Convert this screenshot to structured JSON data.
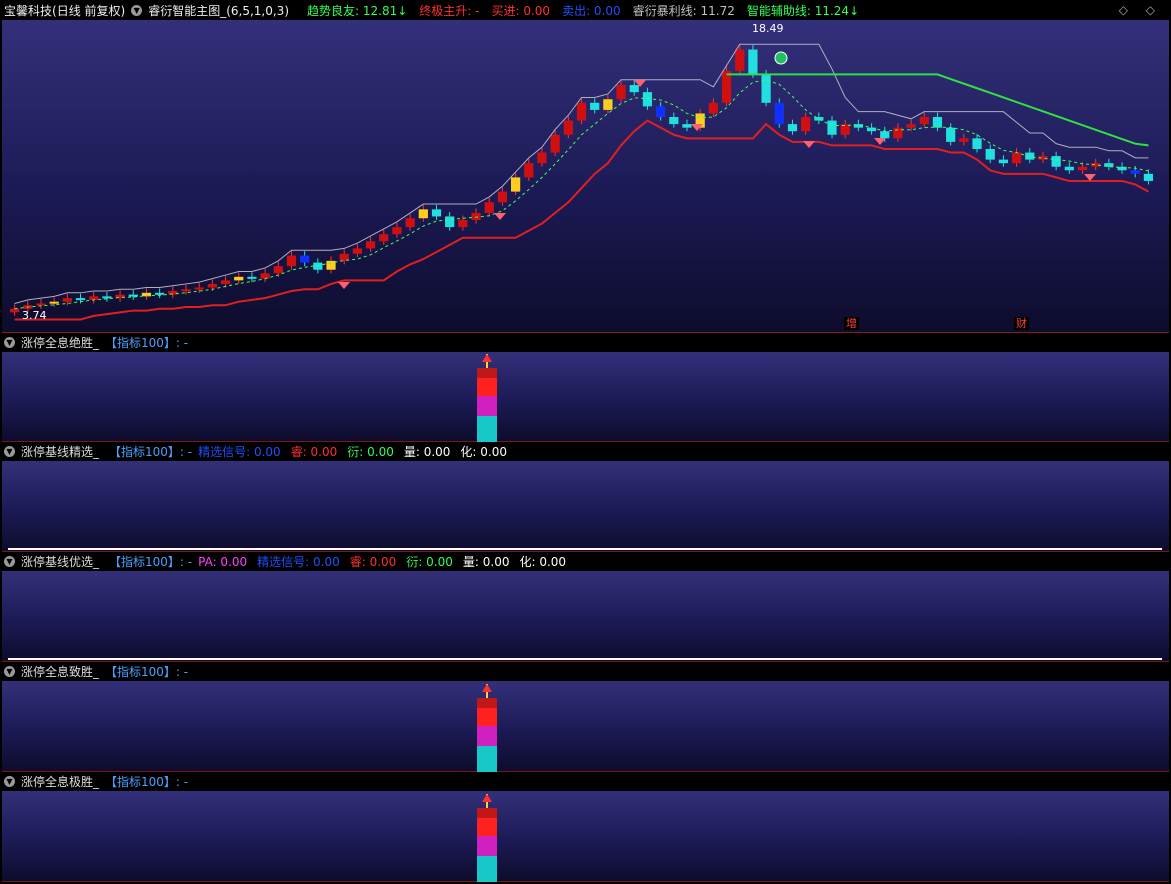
{
  "header": {
    "stock": "宝馨科技",
    "period": "(日线 前复权)",
    "indicator": "睿衍智能主图_(6,5,1,0,3)",
    "legend": [
      {
        "label": "趋势良友:",
        "value": "12.81",
        "arrow": "↓",
        "color": "#33ff55"
      },
      {
        "label": "终极主升:",
        "value": "-",
        "arrow": "",
        "color": "#ff3030"
      },
      {
        "label": "买进:",
        "value": "0.00",
        "arrow": "",
        "color": "#ff3030"
      },
      {
        "label": "卖出:",
        "value": "0.00",
        "arrow": "",
        "color": "#2050ff"
      },
      {
        "label": "睿衍暴利线:",
        "value": "11.72",
        "arrow": "",
        "color": "#c0c0c0"
      },
      {
        "label": "智能辅助线:",
        "value": "11.24",
        "arrow": "↓",
        "color": "#33ff55"
      }
    ],
    "corner_icons": [
      "diamond-icon",
      "chevron-icon"
    ]
  },
  "main_chart": {
    "price_high_label": "18.49",
    "price_low_label": "3.74",
    "markers": [
      "增",
      "财"
    ]
  },
  "subpanels": [
    {
      "name": "涨停全息绝胜_",
      "tag": "【指标100】",
      "suffix": ": -",
      "fields": []
    },
    {
      "name": "涨停基线精选_",
      "tag": "【指标100】",
      "suffix": ": -",
      "fields": [
        {
          "label": "精选信号:",
          "value": "0.00",
          "color": "#2050ff"
        },
        {
          "label": "睿:",
          "value": "0.00",
          "color": "#ff3030"
        },
        {
          "label": "衍:",
          "value": "0.00",
          "color": "#33ff55"
        },
        {
          "label": "量:",
          "value": "0.00",
          "color": "#ffffff"
        },
        {
          "label": "化:",
          "value": "0.00",
          "color": "#ffffff"
        }
      ]
    },
    {
      "name": "涨停基线优选_",
      "tag": "【指标100】",
      "suffix": ": -",
      "fields": [
        {
          "label": "PA:",
          "value": "0.00",
          "color": "#ff40ff"
        },
        {
          "label": "精选信号:",
          "value": "0.00",
          "color": "#2050ff"
        },
        {
          "label": "睿:",
          "value": "0.00",
          "color": "#ff3030"
        },
        {
          "label": "衍:",
          "value": "0.00",
          "color": "#33ff55"
        },
        {
          "label": "量:",
          "value": "0.00",
          "color": "#ffffff"
        },
        {
          "label": "化:",
          "value": "0.00",
          "color": "#ffffff"
        }
      ]
    },
    {
      "name": "涨停全息致胜_",
      "tag": "【指标100】",
      "suffix": ": -",
      "fields": []
    },
    {
      "name": "涨停全息极胜_",
      "tag": "【指标100】",
      "suffix": ": -",
      "fields": []
    }
  ]
}
